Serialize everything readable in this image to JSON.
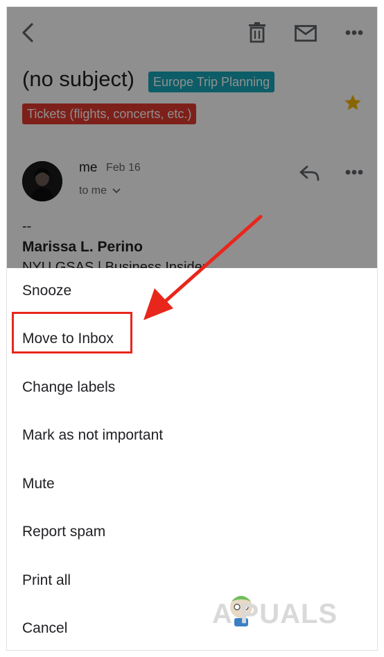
{
  "toolbar": {
    "back_icon": "back-arrow-icon",
    "delete_icon": "trash-icon",
    "mark_unread_icon": "mail-icon",
    "more_icon": "more-horizontal-icon"
  },
  "email": {
    "subject": "(no subject)",
    "labels": [
      {
        "text": "Europe Trip Planning",
        "color": "#16a7b8"
      },
      {
        "text": "Tickets (flights, concerts, etc.)",
        "color": "#e03a2f"
      }
    ],
    "starred": true,
    "star_color": "#f4b400",
    "sender": "me",
    "date": "Feb 16",
    "recipient": "to me",
    "signature": {
      "dash": "--",
      "name": "Marissa L. Perino",
      "org": "NYU GSAS | Business Insider"
    }
  },
  "menu": {
    "items": [
      {
        "label": "Snooze"
      },
      {
        "label": "Move to Inbox",
        "highlighted": true
      },
      {
        "label": "Change labels"
      },
      {
        "label": "Mark as not important"
      },
      {
        "label": "Mute"
      },
      {
        "label": "Report spam"
      },
      {
        "label": "Print all"
      },
      {
        "label": "Cancel"
      }
    ]
  },
  "annotation": {
    "arrow_color": "#e9261b",
    "box_color": "#e9261b"
  },
  "watermark": {
    "text": "A PUALS"
  }
}
